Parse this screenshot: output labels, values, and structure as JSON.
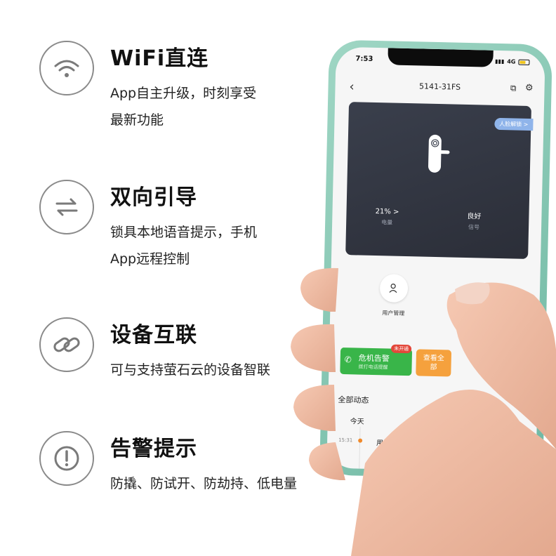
{
  "features": [
    {
      "icon": "wifi-icon",
      "title": "WiFi直连",
      "desc": "App自主升级，时刻享受\n最新功能"
    },
    {
      "icon": "swap-arrows-icon",
      "title": "双向引导",
      "desc": "锁具本地语音提示，手机\nApp远程控制"
    },
    {
      "icon": "link-icon",
      "title": "设备互联",
      "desc": "可与支持萤石云的设备智联"
    },
    {
      "icon": "alert-icon",
      "title": "告警提示",
      "desc": "防撬、防试开、防劫持、低电量"
    }
  ],
  "phone": {
    "status": {
      "time": "7:53",
      "network": "4G"
    },
    "nav": {
      "back": "‹",
      "title": "5141-31FS"
    },
    "card": {
      "badge": "人脸解锁 >",
      "battery_value": "21% >",
      "battery_label": "电量",
      "signal_value": "良好",
      "signal_label": "信号"
    },
    "user_management": "用户管理",
    "alarm": {
      "title": "危机告警",
      "subtitle": "拨打电话提醒",
      "tag": "未开通"
    },
    "view_all": "查看全部",
    "events": {
      "title": "全部动态",
      "today": "今天",
      "items": [
        {
          "time": "15:31",
          "text": "用户 3 开门"
        }
      ]
    }
  },
  "colors": {
    "accent_green": "#39b549",
    "accent_orange": "#f5a13d",
    "phone_frame": "#9fd6c4",
    "badge_blue": "#8fb4ea"
  }
}
